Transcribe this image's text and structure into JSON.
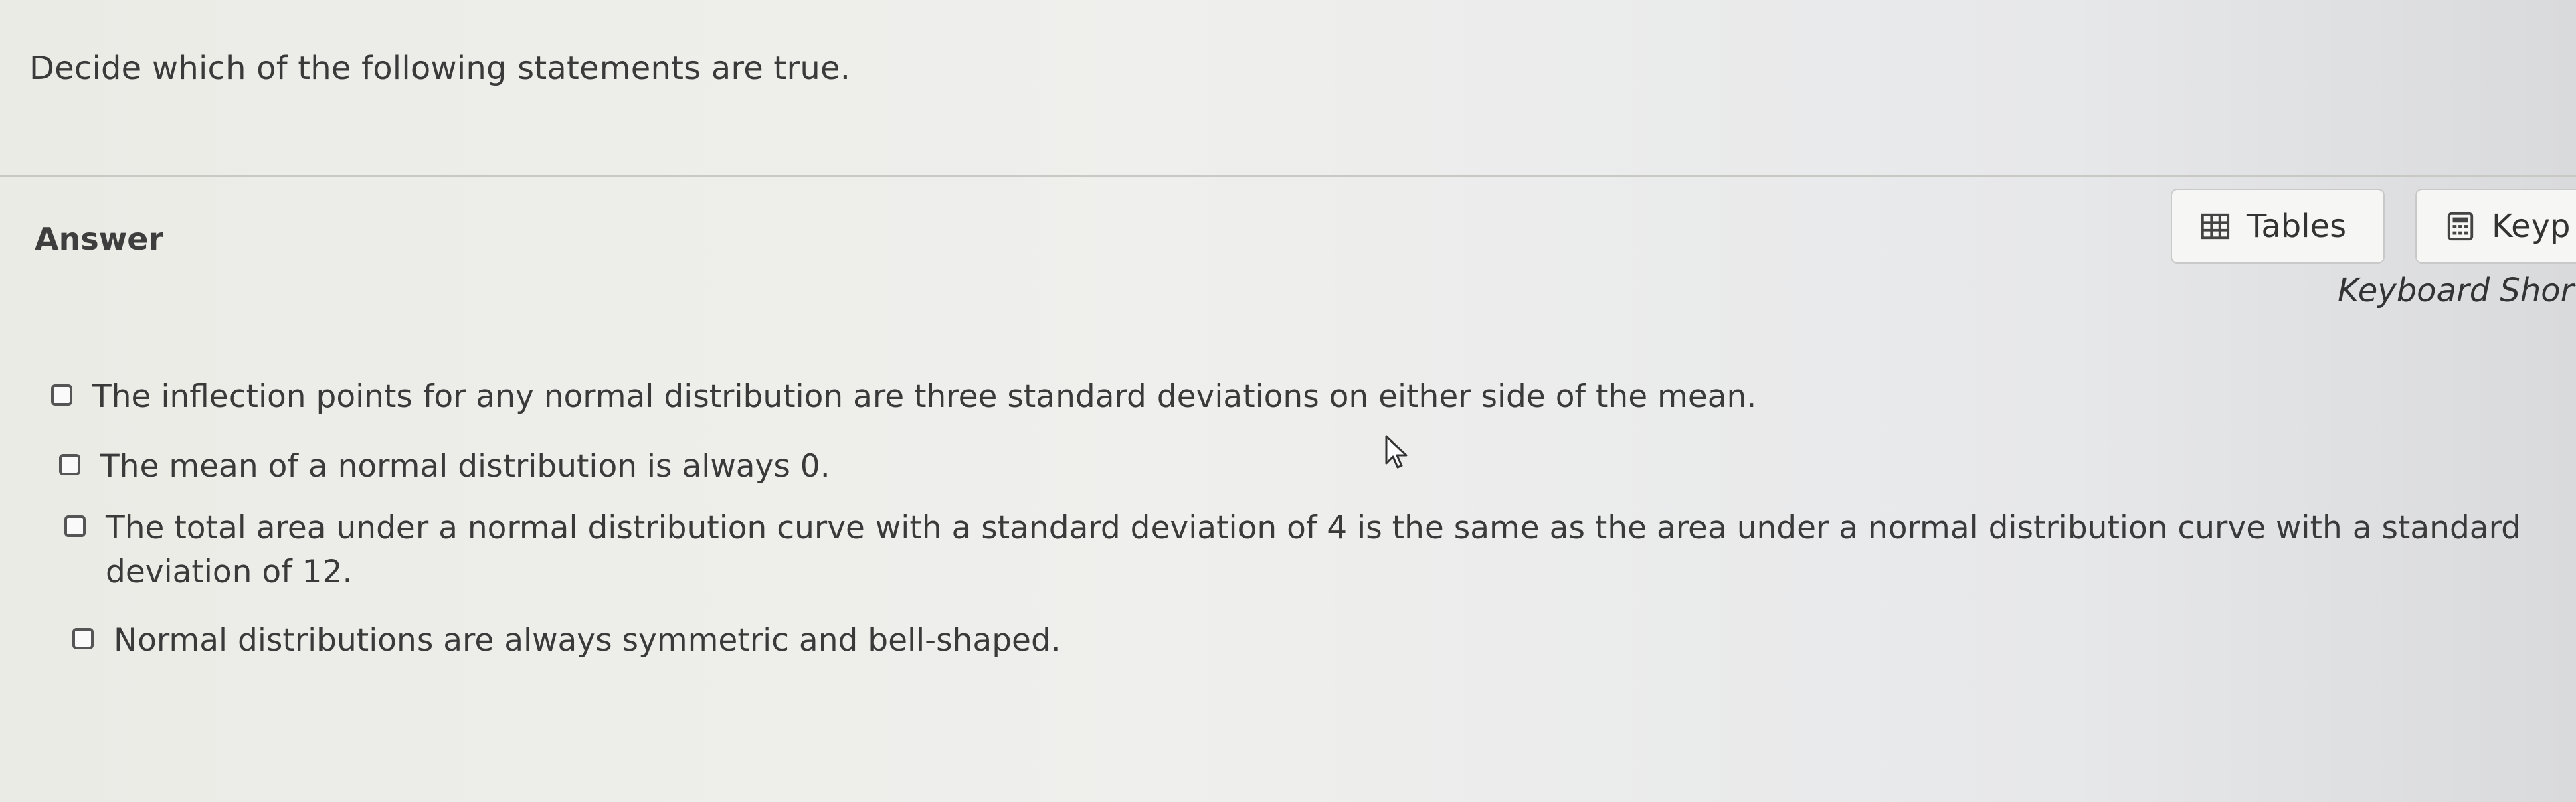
{
  "question": {
    "prompt": "Decide which of the following statements are true."
  },
  "answer": {
    "label": "Answer"
  },
  "toolbar": {
    "tables_label": "Tables",
    "keypad_label": "Keyp",
    "keyboard_shortcuts_label": "Keyboard Short"
  },
  "options": [
    {
      "text": "The inflection points for any normal distribution are three standard deviations on either side of the mean.",
      "checked": false
    },
    {
      "text": "The mean of a normal distribution is always 0.",
      "checked": false
    },
    {
      "text": "The total area under a normal distribution curve with a standard deviation of 4 is the same as the area under a normal distribution curve with a standard deviation of 12.",
      "checked": false
    },
    {
      "text": "Normal distributions are always symmetric and bell-shaped.",
      "checked": false
    }
  ],
  "icons": {
    "tables": "table-grid-icon",
    "keypad": "calculator-icon",
    "cursor": "mouse-pointer-icon"
  }
}
